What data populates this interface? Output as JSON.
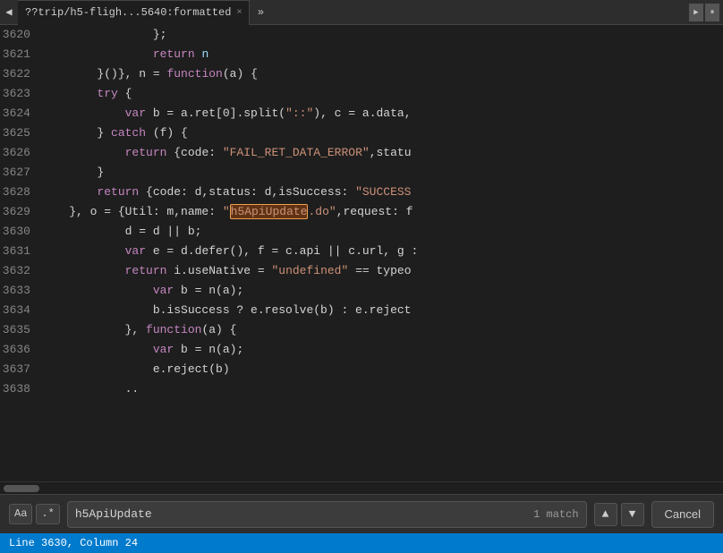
{
  "tab": {
    "label": "??trip/h5-fligh...5640:formatted",
    "close_icon": "×"
  },
  "lines": [
    {
      "num": "3620",
      "tokens": [
        {
          "t": "                };",
          "c": "punct"
        }
      ]
    },
    {
      "num": "3621",
      "tokens": [
        {
          "t": "                ",
          "c": "punct"
        },
        {
          "t": "return",
          "c": "kw"
        },
        {
          "t": " n",
          "c": "ident"
        }
      ]
    },
    {
      "num": "3622",
      "tokens": [
        {
          "t": "        }()}, n = ",
          "c": "punct"
        },
        {
          "t": "function",
          "c": "kw"
        },
        {
          "t": "(a) {",
          "c": "punct"
        }
      ]
    },
    {
      "num": "3623",
      "tokens": [
        {
          "t": "        ",
          "c": "punct"
        },
        {
          "t": "try",
          "c": "kw"
        },
        {
          "t": " {",
          "c": "punct"
        }
      ]
    },
    {
      "num": "3624",
      "tokens": [
        {
          "t": "            ",
          "c": "punct"
        },
        {
          "t": "var",
          "c": "kw"
        },
        {
          "t": " b = a.ret[0].split(",
          "c": "punct"
        },
        {
          "t": "\"::\"",
          "c": "str"
        },
        {
          "t": "), c = a.data,",
          "c": "punct"
        }
      ]
    },
    {
      "num": "3625",
      "tokens": [
        {
          "t": "        } ",
          "c": "punct"
        },
        {
          "t": "catch",
          "c": "kw"
        },
        {
          "t": " (f) {",
          "c": "punct"
        }
      ]
    },
    {
      "num": "3626",
      "tokens": [
        {
          "t": "            ",
          "c": "punct"
        },
        {
          "t": "return",
          "c": "kw"
        },
        {
          "t": " {code: ",
          "c": "punct"
        },
        {
          "t": "\"FAIL_RET_DATA_ERROR\"",
          "c": "str"
        },
        {
          "t": ",statu",
          "c": "punct"
        }
      ]
    },
    {
      "num": "3627",
      "tokens": [
        {
          "t": "        }",
          "c": "punct"
        }
      ]
    },
    {
      "num": "3628",
      "tokens": [
        {
          "t": "        ",
          "c": "punct"
        },
        {
          "t": "return",
          "c": "kw"
        },
        {
          "t": " {code: d,status: d,isSuccess: ",
          "c": "punct"
        },
        {
          "t": "\"SUCCESS",
          "c": "str"
        }
      ]
    },
    {
      "num": "3629",
      "tokens": [
        {
          "t": "    }, o = {Util: m,name: ",
          "c": "punct"
        },
        {
          "t": "\"",
          "c": "str"
        },
        {
          "t": "h5ApiUpdate",
          "c": "str_highlight"
        },
        {
          "t": ".do\"",
          "c": "str"
        },
        {
          "t": ",request: f",
          "c": "punct"
        }
      ]
    },
    {
      "num": "3630",
      "tokens": [
        {
          "t": "            d = d || b;",
          "c": "punct"
        }
      ]
    },
    {
      "num": "3631",
      "tokens": [
        {
          "t": "            ",
          "c": "punct"
        },
        {
          "t": "var",
          "c": "kw"
        },
        {
          "t": " e = d.defer(), f = c.api || c.url, g :",
          "c": "punct"
        }
      ]
    },
    {
      "num": "3632",
      "tokens": [
        {
          "t": "            ",
          "c": "punct"
        },
        {
          "t": "return",
          "c": "kw"
        },
        {
          "t": " i.useNative = ",
          "c": "punct"
        },
        {
          "t": "\"undefined\"",
          "c": "str"
        },
        {
          "t": " == typeo",
          "c": "punct"
        }
      ]
    },
    {
      "num": "3633",
      "tokens": [
        {
          "t": "                ",
          "c": "punct"
        },
        {
          "t": "var",
          "c": "kw"
        },
        {
          "t": " b = n(a);",
          "c": "punct"
        }
      ]
    },
    {
      "num": "3634",
      "tokens": [
        {
          "t": "                b.isSuccess ? e.resolve(b) : e.reject",
          "c": "punct"
        }
      ]
    },
    {
      "num": "3635",
      "tokens": [
        {
          "t": "            }, ",
          "c": "punct"
        },
        {
          "t": "function",
          "c": "kw"
        },
        {
          "t": "(a) {",
          "c": "punct"
        }
      ]
    },
    {
      "num": "3636",
      "tokens": [
        {
          "t": "                ",
          "c": "punct"
        },
        {
          "t": "var",
          "c": "kw"
        },
        {
          "t": " b = n(a);",
          "c": "punct"
        }
      ]
    },
    {
      "num": "3637",
      "tokens": [
        {
          "t": "                e.reject(b)",
          "c": "punct"
        }
      ]
    },
    {
      "num": "3638",
      "tokens": [
        {
          "t": "            ..",
          "c": "punct"
        }
      ]
    }
  ],
  "search": {
    "aa_label": "Aa",
    "regex_label": ".*",
    "input_value": "h5ApiUpdate",
    "match_count": "1 match",
    "up_icon": "▲",
    "down_icon": "▼",
    "cancel_label": "Cancel"
  },
  "status": {
    "text": "Line 3630, Column 24"
  }
}
